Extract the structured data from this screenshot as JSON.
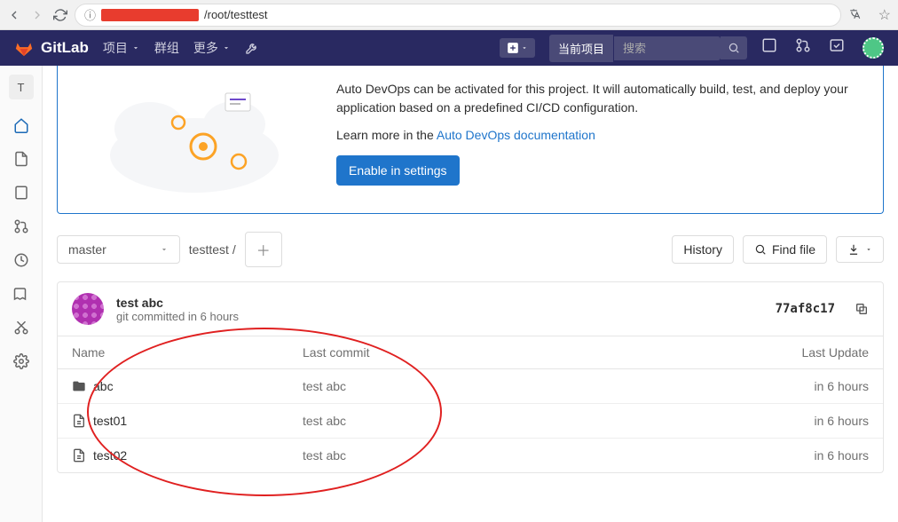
{
  "browser": {
    "url_prefix": "/root/testtest"
  },
  "topnav": {
    "brand": "GitLab",
    "projects": "项目",
    "groups": "群组",
    "more": "更多",
    "search_label": "当前项目",
    "search_placeholder": "搜索"
  },
  "sidebar": {
    "project_letter": "T"
  },
  "banner": {
    "line1": "Auto DevOps can be activated for this project. It will automatically build, test, and deploy your application based on a predefined CI/CD configuration.",
    "learn_prefix": "Learn more in the ",
    "learn_link": "Auto DevOps documentation",
    "button": "Enable in settings"
  },
  "tree": {
    "branch": "master",
    "breadcrumb_root": "testtest",
    "history": "History",
    "find_file": "Find file"
  },
  "commit": {
    "title": "test abc",
    "meta": "git committed in 6 hours",
    "sha": "77af8c17"
  },
  "table": {
    "header_name": "Name",
    "header_commit": "Last commit",
    "header_update": "Last Update",
    "rows": [
      {
        "type": "folder",
        "name": "abc",
        "commit": "test abc",
        "update": "in 6 hours"
      },
      {
        "type": "file",
        "name": "test01",
        "commit": "test abc",
        "update": "in 6 hours"
      },
      {
        "type": "file",
        "name": "test02",
        "commit": "test abc",
        "update": "in 6 hours"
      }
    ]
  }
}
